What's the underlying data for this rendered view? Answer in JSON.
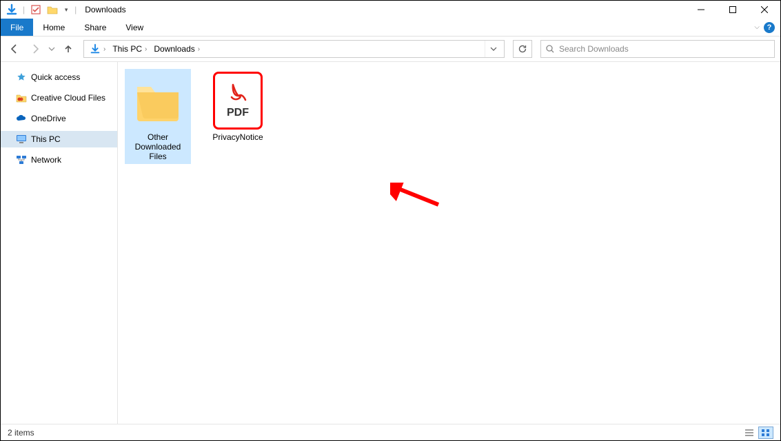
{
  "window": {
    "title": "Downloads"
  },
  "menu": {
    "file": "File",
    "home": "Home",
    "share": "Share",
    "view": "View"
  },
  "breadcrumbs": {
    "root": "This PC",
    "current": "Downloads"
  },
  "search": {
    "placeholder": "Search Downloads"
  },
  "sidebar": {
    "quick_access": "Quick access",
    "creative_cloud": "Creative Cloud Files",
    "onedrive": "OneDrive",
    "this_pc": "This PC",
    "network": "Network"
  },
  "items": {
    "folder": {
      "line1": "Other",
      "line2": "Downloaded",
      "line3": "Files"
    },
    "pdf": {
      "name": "PrivacyNotice",
      "badge": "PDF"
    }
  },
  "status": {
    "count": "2 items"
  }
}
